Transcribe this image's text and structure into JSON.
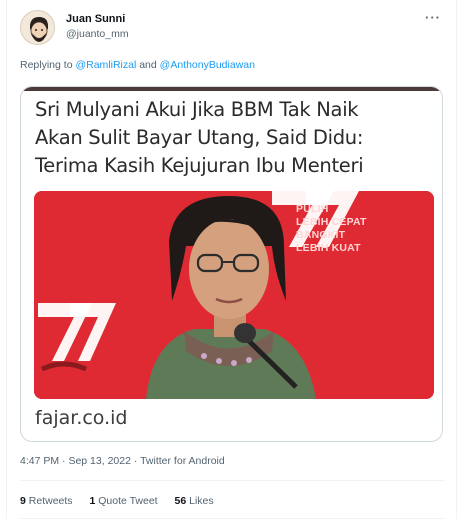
{
  "author": {
    "name": "Juan Sunni",
    "handle": "@juanto_mm",
    "avatar_icon": "cartoon-face-avatar"
  },
  "more_icon": "more-dots-icon",
  "more_label": "···",
  "reply": {
    "prefix": "Replying to ",
    "mention1": "@RamliRizal",
    "conj": " and ",
    "mention2": "@AnthonyBudiawan"
  },
  "card": {
    "headline": "Sri Mulyani Akui Jika BBM Tak Naik\nAkan Sulit Bayar Utang, Said Didu:\nTerima Kasih Kejujuran Ibu Menteri",
    "photo_overlay_line1": "PULIH",
    "photo_overlay_line2": "LEBIH CEPAT",
    "photo_overlay_line3": "BANGKIT",
    "photo_overlay_line4": "LEBIH KUAT",
    "domain": "fajar.co.id"
  },
  "meta": {
    "time": "4:47 PM",
    "sep1": " · ",
    "date": "Sep 13, 2022",
    "sep2": " · ",
    "source": "Twitter for Android"
  },
  "stats": {
    "retweets_count": "9",
    "retweets_label": "Retweets",
    "quotes_count": "1",
    "quotes_label": "Quote Tweet",
    "likes_count": "56",
    "likes_label": "Likes"
  },
  "colors": {
    "accent": "#1d9bf0",
    "muted": "#536471",
    "photo_bg": "#e02a33"
  }
}
